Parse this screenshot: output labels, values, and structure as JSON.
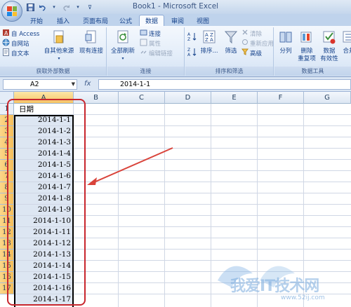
{
  "window": {
    "title": "Book1 - Microsoft Excel"
  },
  "tabs": [
    {
      "label": "开始",
      "active": false
    },
    {
      "label": "插入",
      "active": false
    },
    {
      "label": "页面布局",
      "active": false
    },
    {
      "label": "公式",
      "active": false
    },
    {
      "label": "数据",
      "active": true
    },
    {
      "label": "审阅",
      "active": false
    },
    {
      "label": "视图",
      "active": false
    }
  ],
  "ribbon": {
    "external": {
      "label": "获取外部数据",
      "from_access": "自 Access",
      "from_web": "自网站",
      "from_text": "自文本",
      "other_sources": "自其他来源",
      "existing": "现有连接"
    },
    "connections": {
      "label": "连接",
      "refresh_all": "全部刷新",
      "connections": "连接",
      "properties": "属性",
      "edit_links": "编辑链接"
    },
    "sort": {
      "label": "排序和筛选",
      "sort": "排序...",
      "filter": "筛选",
      "clear": "清除",
      "reapply": "重新应用",
      "advanced": "高级"
    },
    "tools": {
      "label": "数据工具",
      "split": "分列",
      "remove_dup": "删除",
      "remove_dup2": "重复项",
      "validate": "数据",
      "validate2": "有效性",
      "consolidate": "合并"
    }
  },
  "formula_bar": {
    "name_box": "A2",
    "fx": "fx",
    "formula": "2014-1-1"
  },
  "sheet": {
    "columns": [
      "A",
      "B",
      "C",
      "D",
      "E",
      "F",
      "G"
    ],
    "rows": [
      "1",
      "2",
      "3",
      "4",
      "5",
      "6",
      "7",
      "8",
      "9",
      "10",
      "11",
      "12",
      "13",
      "14",
      "15",
      "16",
      "17"
    ],
    "header_cell": "日期",
    "dates": [
      "2014-1-1",
      "2014-1-2",
      "2014-1-3",
      "2014-1-4",
      "2014-1-5",
      "2014-1-6",
      "2014-1-7",
      "2014-1-8",
      "2014-1-9",
      "2014-1-10",
      "2014-1-11",
      "2014-1-12",
      "2014-1-13",
      "2014-1-14",
      "2014-1-15",
      "2014-1-16",
      "2014-1-17"
    ]
  },
  "watermark": {
    "text": "我爱IT技术网",
    "url": "www.52ij.com"
  },
  "colors": {
    "annotation_red": "#c8262d",
    "selection_orange": "#f5c365"
  }
}
